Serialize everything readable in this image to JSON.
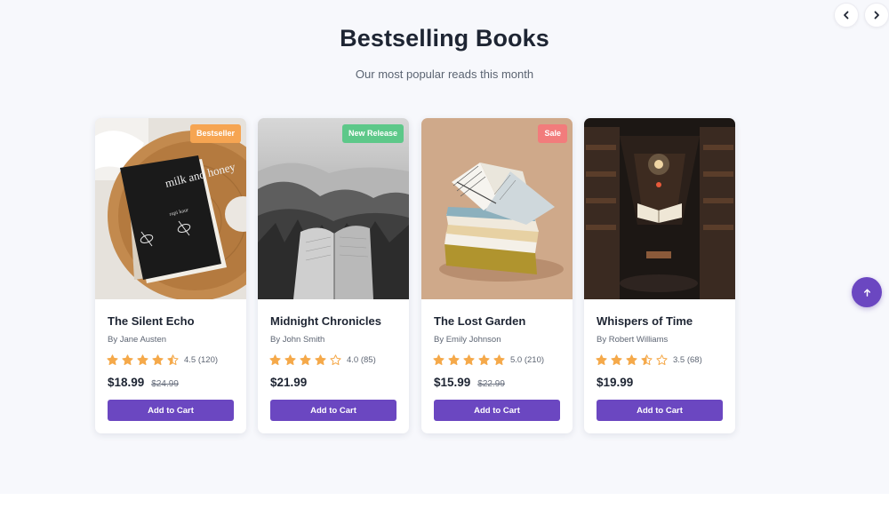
{
  "header": {
    "title": "Bestselling Books",
    "subtitle": "Our most popular reads this month"
  },
  "navigation": {
    "prev_icon": "chevron-left-icon",
    "next_icon": "chevron-right-icon"
  },
  "scroll_top": {
    "icon": "arrow-up-icon"
  },
  "colors": {
    "accent": "#6b47c1",
    "star": "#f5a94a",
    "badge_bestseller": "#f6a552",
    "badge_new_release": "#5dc889",
    "badge_sale": "#f27c7c"
  },
  "books": [
    {
      "title": "The Silent Echo",
      "author": "By Jane Austen",
      "rating": 4.5,
      "rating_text": "4.5 (120)",
      "price": "$18.99",
      "old_price": "$24.99",
      "badge": "Bestseller",
      "button_label": "Add to Cart"
    },
    {
      "title": "Midnight Chronicles",
      "author": "By John Smith",
      "rating": 4.0,
      "rating_text": "4.0 (85)",
      "price": "$21.99",
      "old_price": "",
      "badge": "New Release",
      "button_label": "Add to Cart"
    },
    {
      "title": "The Lost Garden",
      "author": "By Emily Johnson",
      "rating": 5.0,
      "rating_text": "5.0 (210)",
      "price": "$15.99",
      "old_price": "$22.99",
      "badge": "Sale",
      "button_label": "Add to Cart"
    },
    {
      "title": "Whispers of Time",
      "author": "By Robert Williams",
      "rating": 3.5,
      "rating_text": "3.5 (68)",
      "price": "$19.99",
      "old_price": "",
      "badge": "",
      "button_label": "Add to Cart"
    }
  ],
  "cover_text": {
    "book1_title": "milk and honey",
    "book1_author": "rupi kaur"
  }
}
